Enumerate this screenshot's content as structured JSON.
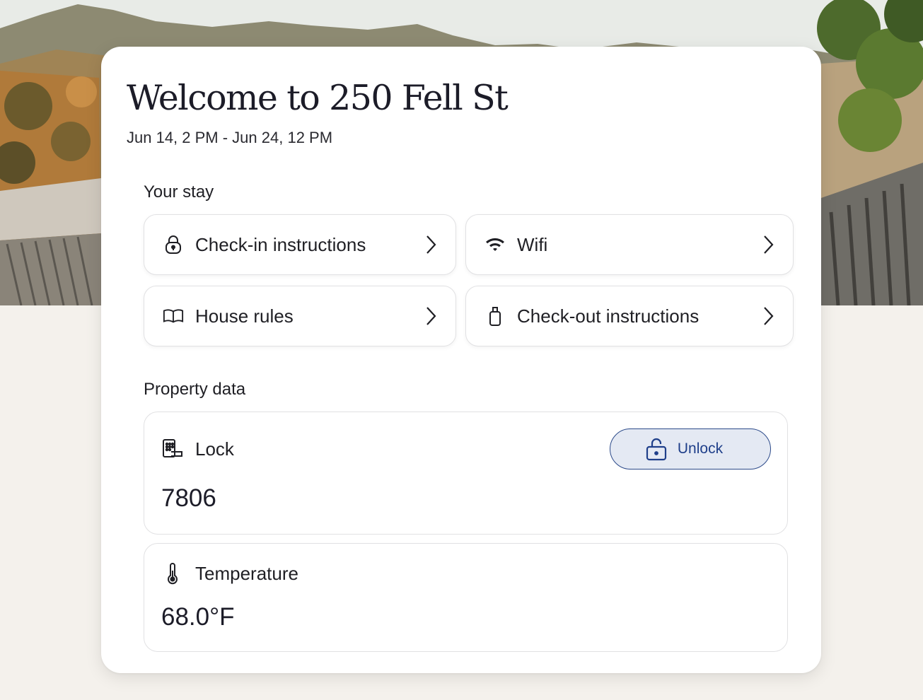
{
  "page": {
    "title": "Welcome to 250 Fell St",
    "dates": "Jun 14, 2 PM - Jun 24, 12 PM"
  },
  "your_stay": {
    "label": "Your stay",
    "tiles": [
      {
        "label": "Check-in instructions",
        "icon": "lock-icon"
      },
      {
        "label": "Wifi",
        "icon": "wifi-icon"
      },
      {
        "label": "House rules",
        "icon": "book-icon"
      },
      {
        "label": "Check-out instructions",
        "icon": "luggage-icon"
      }
    ]
  },
  "property_data": {
    "label": "Property data",
    "lock": {
      "label": "Lock",
      "value": "7806",
      "icon": "keypad-lock-icon",
      "unlock_label": "Unlock"
    },
    "temperature": {
      "label": "Temperature",
      "value": "68.0°F",
      "icon": "thermometer-icon"
    }
  },
  "colors": {
    "accent": "#1f3f8a",
    "unlock_bg": "#e4e9f3",
    "page_bg": "#f4f1ec"
  }
}
